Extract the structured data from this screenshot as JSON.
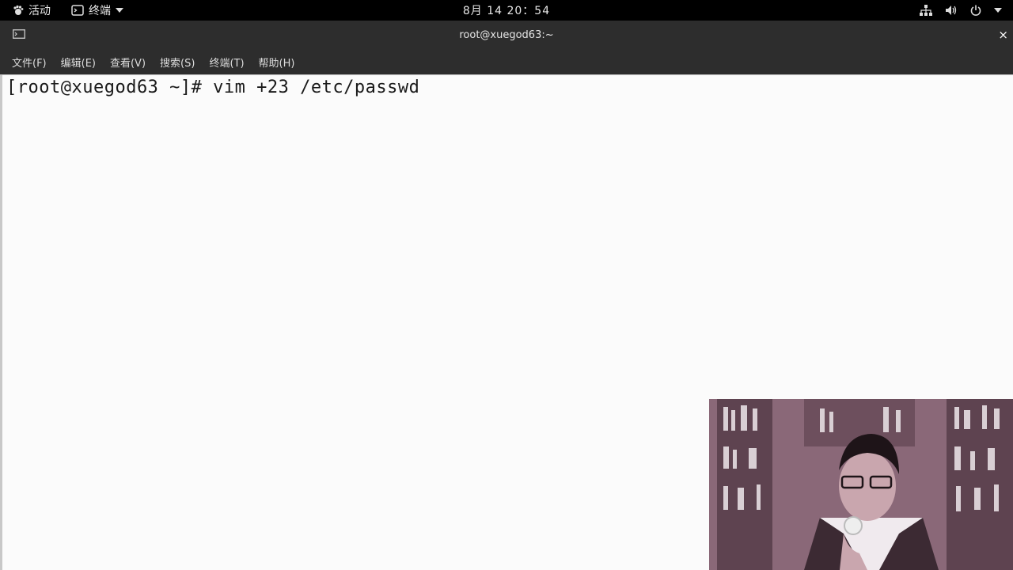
{
  "topbar": {
    "activities": "活动",
    "app_menu": "终端",
    "clock": "8月 14 20：54"
  },
  "window": {
    "title": "root@xuegod63:~",
    "close_glyph": "×"
  },
  "menubar": {
    "items": [
      "文件(F)",
      "编辑(E)",
      "查看(V)",
      "搜索(S)",
      "终端(T)",
      "帮助(H)"
    ]
  },
  "terminal": {
    "prompt": "[root@xuegod63 ~]#",
    "command": "vim +23 /etc/passwd"
  },
  "icons": {
    "activities": "gnome-foot-icon",
    "app": "terminal-icon",
    "dropdown": "triangle-down-icon",
    "network": "network-icon",
    "volume": "volume-icon",
    "power": "power-icon",
    "window": "terminal-window-icon"
  },
  "colors": {
    "topbar_bg": "#000000",
    "titlebar_bg": "#2d2d2d",
    "terminal_bg": "#fbfbfb",
    "terminal_fg": "#1a1a1a"
  }
}
